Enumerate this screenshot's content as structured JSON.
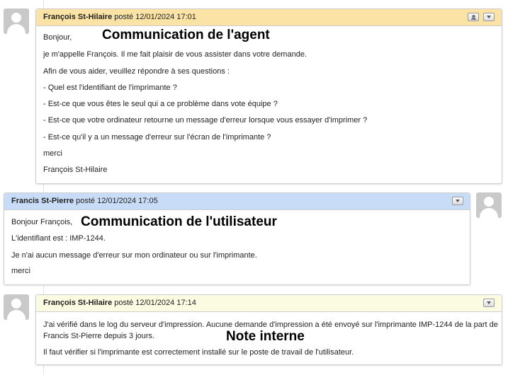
{
  "messages": [
    {
      "author": "François St-Hilaire",
      "meta": "posté 12/01/2024 17:01",
      "header_color": "#fbe3a5",
      "lines": [
        "Bonjour,",
        "je m'appelle François. Il me fait plaisir de vous assister dans votre demande.",
        "Afin de vous aider, veuillez répondre à ses questions :",
        "- Quel est l'identifiant de l'imprimante ?",
        "- Est-ce que vous êtes le seul qui a ce problème dans vote équipe ?",
        "- Est-ce que votre ordinateur retourne un message d'erreur lorsque vous essayer d'imprimer ?",
        "- Est-ce qu'il y a un message d'erreur sur l'écran de l'imprimante ?",
        "merci",
        "François St-Hilaire"
      ],
      "annotation": "Communication de l'agent"
    },
    {
      "author": "Francis St-Pierre",
      "meta": "posté 12/01/2024 17:05",
      "header_color": "#c9dcf7",
      "lines": [
        "Bonjour François,",
        "L'identifiant est : IMP-1244.",
        "Je n'ai aucun message d'erreur sur mon ordinateur ou sur l'imprimante.",
        "merci"
      ],
      "annotation": "Communication de l'utilisateur"
    },
    {
      "author": "François St-Hilaire",
      "meta": "posté 12/01/2024 17:14",
      "header_color": "#fbfbe2",
      "lines": [
        "J'ai vérifié dans le log du serveur d'impression. Aucune demande d'impression a été envoyé sur l'imprimante IMP-1244 de la part de",
        "Francis St-Pierre depuis 3 jours.",
        "Il faut vérifier si l'imprimante est correctement installé sur le poste de travail de l'utilisateur."
      ],
      "annotation": "Note interne"
    }
  ]
}
